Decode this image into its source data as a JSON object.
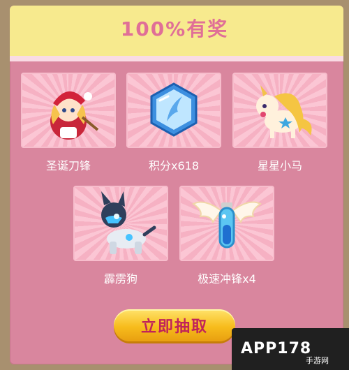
{
  "panel": {
    "title": "100%有奖"
  },
  "rewards": [
    {
      "label": "圣诞刀锋",
      "icon": "christmas-hero-icon"
    },
    {
      "label": "积分x618",
      "icon": "crystal-points-icon"
    },
    {
      "label": "星星小马",
      "icon": "star-pony-icon"
    },
    {
      "label": "霹雳狗",
      "icon": "robot-dog-icon"
    },
    {
      "label": "极速冲锋x4",
      "icon": "winged-potion-icon"
    }
  ],
  "draw_button": {
    "label": "立即抽取"
  },
  "watermark": {
    "logo": "APP178",
    "sub": "手游网"
  },
  "colors": {
    "panel": "#d9869e",
    "header": "#f7ea8e",
    "title": "#e06f97",
    "button": "#f7bc1c",
    "button_text": "#c0235a"
  }
}
